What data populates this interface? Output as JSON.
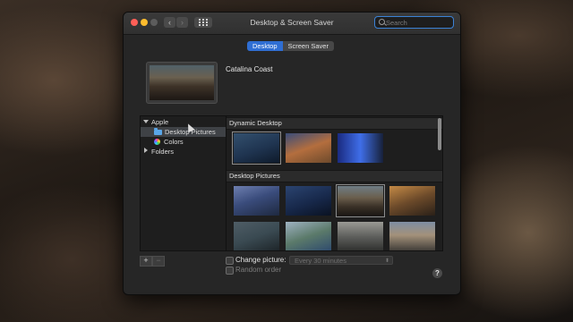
{
  "window": {
    "title": "Desktop & Screen Saver"
  },
  "toolbar": {
    "back_icon": "chevron-left-icon",
    "forward_icon": "chevron-right-icon",
    "grid_icon": "grid-icon"
  },
  "search": {
    "placeholder": "Search",
    "value": ""
  },
  "tabs": [
    {
      "label": "Desktop",
      "selected": true
    },
    {
      "label": "Screen Saver",
      "selected": false
    }
  ],
  "current_wallpaper": {
    "name": "Catalina Coast"
  },
  "sources": {
    "apple": {
      "label": "Apple",
      "expanded": true
    },
    "desktop_pictures": {
      "label": "Desktop Pictures",
      "selected": true,
      "icon": "folder-icon"
    },
    "colors": {
      "label": "Colors",
      "icon": "colors-icon"
    },
    "folders": {
      "label": "Folders",
      "expanded": false
    }
  },
  "sections": {
    "dynamic": {
      "title": "Dynamic Desktop"
    },
    "pictures": {
      "title": "Desktop Pictures"
    }
  },
  "controls": {
    "add_label": "+",
    "remove_label": "−",
    "change_picture": {
      "label": "Change picture:",
      "checked": false,
      "interval": "Every 30 minutes"
    },
    "random_order": {
      "label": "Random order",
      "checked": false
    },
    "help_label": "?"
  },
  "colors": {
    "accent": "#2f6ed3",
    "close": "#fe5f57",
    "minimize": "#febc2e"
  }
}
